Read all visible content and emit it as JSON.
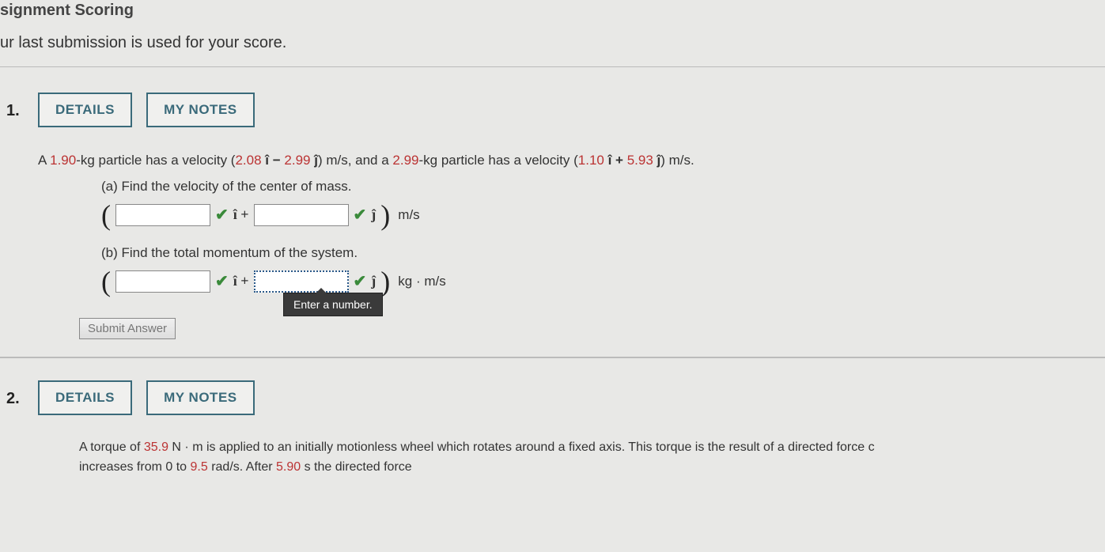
{
  "header": {
    "title": "signment Scoring",
    "note": "ur last submission is used for your score."
  },
  "buttons": {
    "details": "DETAILS",
    "mynotes": "MY NOTES",
    "submit": "Submit Answer"
  },
  "q1": {
    "number": "1.",
    "text_pre": "A ",
    "mass1": "1.90",
    "text_mid1": "-kg particle has a velocity (",
    "vx1": "2.08",
    "ihat1": " î − ",
    "vy1": "2.99",
    "jhat1": " ĵ",
    "text_mid2": ") m/s, and a ",
    "mass2": "2.99",
    "text_mid3": "-kg particle has a velocity (",
    "vx2": "1.10",
    "ihat2": " î + ",
    "vy2": "5.93",
    "jhat2": " ĵ",
    "text_end": ") m/s.",
    "a": {
      "label": "(a) Find the velocity of the center of mass.",
      "units": "m/s"
    },
    "b": {
      "label": "(b) Find the total momentum of the system.",
      "units": "kg · m/s"
    },
    "tooltip": "Enter a number.",
    "ihat": "î +",
    "jhat": "ĵ"
  },
  "q2": {
    "number": "2.",
    "text_pre": "A torque of ",
    "torque": "35.9",
    "text_mid": " N · m is applied to an initially motionless wheel which rotates around a fixed axis. This torque is the result of a directed force c",
    "line2_pre": "increases from 0 to ",
    "omega": "9.5",
    "line2_mid": " rad/s. After ",
    "time": "5.90",
    "line2_end": " s the directed force"
  }
}
